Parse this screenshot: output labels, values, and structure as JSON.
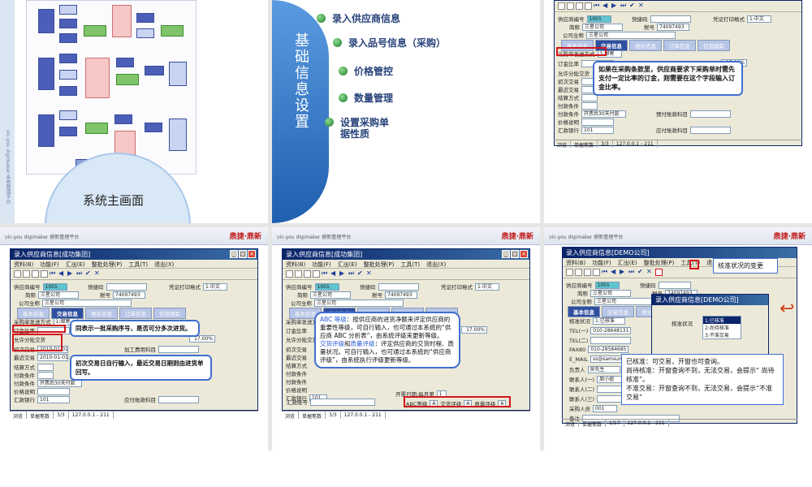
{
  "slide1": {
    "caption": "系统主画面",
    "sidebar_text": "vic-you digimaker 系统管理平台"
  },
  "slide2": {
    "vertical_title": "基础信息设置",
    "items": [
      "录入供应商信息",
      "录入品号信息（采购）",
      "价格管控",
      "数量管理",
      "设置采购单",
      "据性质"
    ]
  },
  "app": {
    "brand": "vic-you digimaker 鼎新管理平台",
    "logo": "鼎捷·鼎新",
    "window_title": "录入供应商信息[成功集团]",
    "menu": [
      "资料(B)",
      "功能(F)",
      "汇出(E)",
      "整批处理(P)",
      "工具(T)",
      "退出(X)"
    ],
    "labels": {
      "supplier_no": "供应商编号",
      "short_name": "简称",
      "full_name": "公司全称",
      "contact": "快捷码",
      "print_format": "凭证打印格式",
      "tax": "税号",
      "purchase_method": "采购单发送方式",
      "deposit_ratio": "订金比率",
      "close_code": "结算方式",
      "pay_terms": "付款条件",
      "pay_method": "付款条件",
      "price_desc": "价格说明",
      "bank": "汇款银行",
      "bank_account": "汇款账号",
      "ar_account": "应付账款科目",
      "expiry": "开票日期:每月第",
      "abc": "ABC等级",
      "quality": "质量评级",
      "delivery": "交货评级",
      "first_trade": "初次交易",
      "last_trade": "最近交易",
      "partial": "允许分批交货",
      "prepay_acct": "预付账款科目",
      "processing_acct": "加工费用科目",
      "payee": "收款人"
    },
    "values": {
      "supplier_no": "1001",
      "short_name": "三星公司",
      "full_name": "三星公司",
      "tax": "74097493",
      "print_format": "1:中文",
      "purchase_method": "1:邮寄",
      "deposit_ratio": "10.00",
      "tax_rate": "17.00%",
      "first_trade": "2010-01-01",
      "last_trade": "2010-01-01",
      "bank": "101",
      "bank_name": "中国农业银行中国农业银",
      "pay_method": "开票后30天付款",
      "day": "1",
      "months": "10",
      "abc_val": "A",
      "quality_val": "A",
      "delivery_val": "A",
      "pay_days": "日"
    },
    "tabs": [
      "基本信息",
      "交易信息",
      "地址信息",
      "订单信息",
      "信息跟踪"
    ],
    "status": [
      "浏览",
      "单据笔数",
      "3/3",
      "127.0.0.1 - 211"
    ]
  },
  "slide3": {
    "note": "如果在采购条款里，供应商要求下采购单时需先支付一定比率的订金，则需要在这个字段输入订金比率。"
  },
  "slide4": {
    "note1": "同表示一批采购序号，是否可分多次进货。",
    "note2": "初次交易日自行输入，最近交易日期则由进货单回写。"
  },
  "slide5": {
    "note_part1": "ABC 等级",
    "note_text1": "：按供应商的进货净额来评定供应商的重要性等级，可自行输入，也可通过本系统的“供应商 ABC 分析表”，由系统评级来更新等级。",
    "note_part2": "交货评级",
    "note_and": "和",
    "note_part3": "质量评级",
    "note_text2": "：评定供应商的交货时程、质量状况。可自行输入，也可通过本系统的“供应商评级”，由系统执行评级更新等级。"
  },
  "slide6": {
    "window_title": "录入供应商信息[DEMO公司]",
    "title_label": "核准状况的变更",
    "menu": [
      "资料(B)",
      "功能(F)",
      "汇出(E)",
      "整批处理(P)",
      "工具(T)",
      "退出(X)"
    ],
    "tabs": [
      "基本信息",
      "交易信息",
      "地址信息"
    ],
    "labels": [
      "核准状况",
      "TEL(一)",
      "TEL(二)",
      "FAX80",
      "E_MAIL",
      "负责人",
      "联系人(一)",
      "联系人(二)",
      "联系人(三)",
      "采购人员",
      "备注"
    ],
    "values": [
      "1:已核准",
      "010-28648131",
      "",
      "010-28584685",
      "ss@samsung.com",
      "吴先生",
      "周小姐",
      "",
      "",
      "001",
      ""
    ],
    "popup_title": "录入供应商信息[DEMO公司]",
    "popup_label": "核准状况",
    "popup_options": [
      "1:已核准",
      "2:尚待核准",
      "3:不准交易"
    ],
    "note": [
      "已核准：可交易，开窗也可查询。",
      "尚待核准：开窗查询不到，无法交易，会提示“ 尚待核准”。",
      "不准交易：开窗查询不到，无法交易，会提示“不准交易”"
    ],
    "status": [
      "浏览",
      "单据笔数",
      "1/17",
      "127.0.0.1 - 211"
    ]
  }
}
